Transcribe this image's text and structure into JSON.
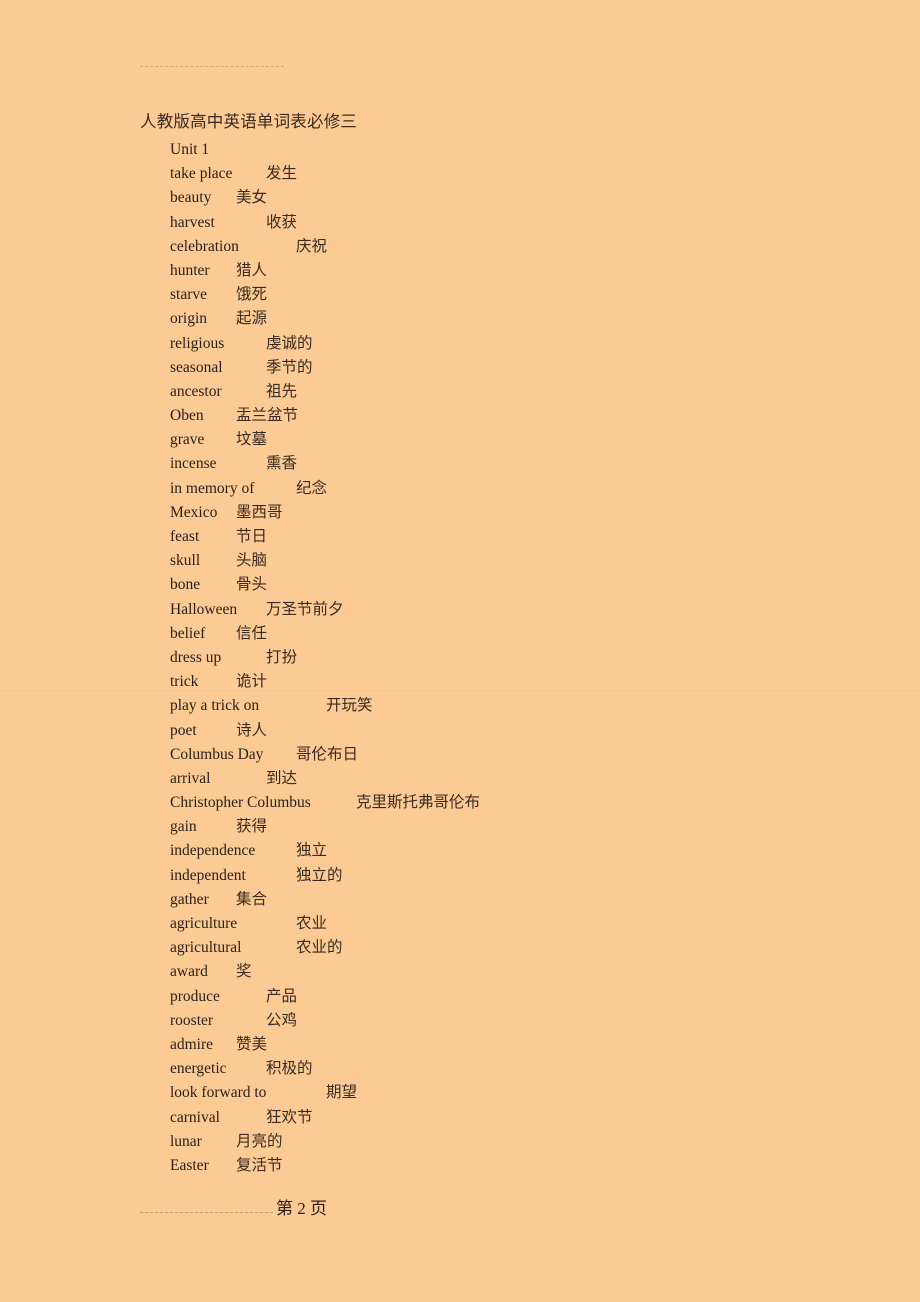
{
  "document": {
    "title": "人教版高中英语单词表必修三",
    "background_color": "#fccb95",
    "text_color": "#2b2018"
  },
  "section_heading": "Unit 1",
  "vocabulary": [
    {
      "term": "take place",
      "gloss": "发生"
    },
    {
      "term": "beauty",
      "gloss": "美女"
    },
    {
      "term": "harvest",
      "gloss": "收获"
    },
    {
      "term": "celebration",
      "gloss": "庆祝"
    },
    {
      "term": "hunter",
      "gloss": "猎人"
    },
    {
      "term": "starve",
      "gloss": "饿死"
    },
    {
      "term": "origin",
      "gloss": "起源"
    },
    {
      "term": "religious",
      "gloss": "虔诚的"
    },
    {
      "term": "seasonal",
      "gloss": "季节的"
    },
    {
      "term": "ancestor",
      "gloss": "祖先"
    },
    {
      "term": "Oben",
      "gloss": "盂兰盆节"
    },
    {
      "term": "grave",
      "gloss": "坟墓"
    },
    {
      "term": "incense",
      "gloss": "熏香"
    },
    {
      "term": "in memory of",
      "gloss": "纪念"
    },
    {
      "term": "Mexico",
      "gloss": "墨西哥"
    },
    {
      "term": "feast",
      "gloss": "节日"
    },
    {
      "term": "skull",
      "gloss": "头脑"
    },
    {
      "term": "bone",
      "gloss": "骨头"
    },
    {
      "term": "Halloween",
      "gloss": "万圣节前夕"
    },
    {
      "term": "belief",
      "gloss": "信任"
    },
    {
      "term": "dress up",
      "gloss": "打扮"
    },
    {
      "term": "trick",
      "gloss": "诡计"
    },
    {
      "term": "play a trick on",
      "gloss": "开玩笑"
    },
    {
      "term": "poet",
      "gloss": "诗人"
    },
    {
      "term": "Columbus Day",
      "gloss": "哥伦布日"
    },
    {
      "term": "arrival",
      "gloss": "到达"
    },
    {
      "term": "Christopher Columbus",
      "gloss": "克里斯托弗哥伦布"
    },
    {
      "term": "gain",
      "gloss": "获得"
    },
    {
      "term": "independence",
      "gloss": "独立"
    },
    {
      "term": "independent",
      "gloss": "独立的"
    },
    {
      "term": "gather",
      "gloss": "集合"
    },
    {
      "term": "agriculture",
      "gloss": "农业"
    },
    {
      "term": "agricultural",
      "gloss": "农业的"
    },
    {
      "term": "award",
      "gloss": "奖"
    },
    {
      "term": "produce",
      "gloss": "产品"
    },
    {
      "term": "rooster",
      "gloss": "公鸡"
    },
    {
      "term": "admire",
      "gloss": "赞美"
    },
    {
      "term": "energetic",
      "gloss": "积极的"
    },
    {
      "term": "look forward to",
      "gloss": "期望"
    },
    {
      "term": "carnival",
      "gloss": "狂欢节"
    },
    {
      "term": "lunar",
      "gloss": "月亮的"
    },
    {
      "term": "Easter",
      "gloss": "复活节"
    }
  ],
  "footer": {
    "page_label": "第 2 页"
  }
}
